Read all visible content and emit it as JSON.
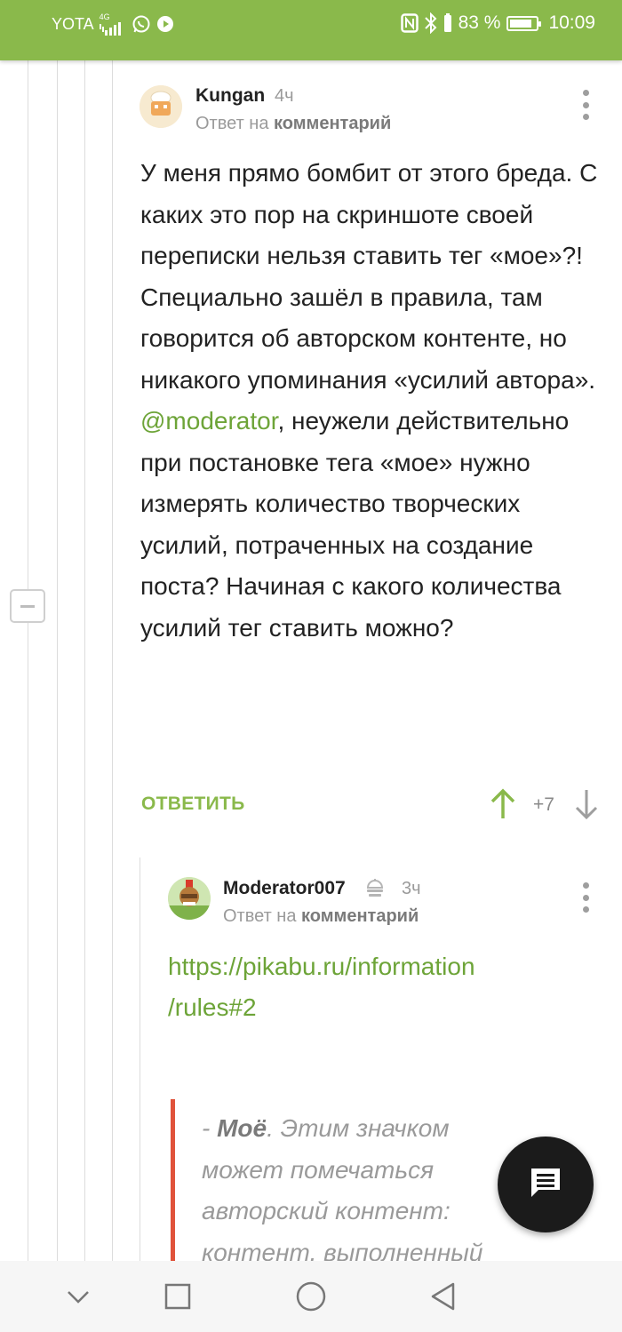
{
  "status_bar": {
    "carrier": "YOTA",
    "network": "4G",
    "battery_percent": "83 %",
    "time": "10:09"
  },
  "comment_1": {
    "author": "Kungan",
    "time": "4ч",
    "reply_prefix": "Ответ на",
    "reply_target": "комментарий",
    "paragraph_1": "У меня прямо бомбит от этого бреда. С каких это пор на скриншоте своей переписки нельзя ставить тег «мое»?! Специально зашёл в правила, там говорится об авторском контенте, но никакого упоминания «усилий автора».",
    "mention": "@moderator",
    "paragraph_2": ", неужели действительно при постановке тега «мое» нужно измерять количество творческих усилий, потраченных на создание поста? Начиная с какого количества усилий тег ставить можно?",
    "reply_button": "ОТВЕТИТЬ",
    "rating": "+7"
  },
  "comment_2": {
    "author": "Moderator007",
    "time": "3ч",
    "reply_prefix": "Ответ на",
    "reply_target": "комментарий",
    "link": "https://pikabu.ru/information/rules#2",
    "quote_lead": "- ",
    "quote_bold": "Моё",
    "quote_text": ". Этим значком может помечаться авторский контент: контент, выполненный"
  },
  "colors": {
    "accent_green": "#8ab94b",
    "link_green": "#6da438",
    "quote_bar": "#e0533b",
    "fab": "#1b1b1b"
  },
  "icons": [
    "whatsapp-icon",
    "nfc-icon",
    "bluetooth-icon",
    "battery-icon",
    "more-vert-icon",
    "arrow-up-icon",
    "arrow-down-icon",
    "moderator-badge-icon",
    "comment-icon",
    "back-icon",
    "home-icon",
    "recents-icon",
    "chevron-down-icon"
  ]
}
